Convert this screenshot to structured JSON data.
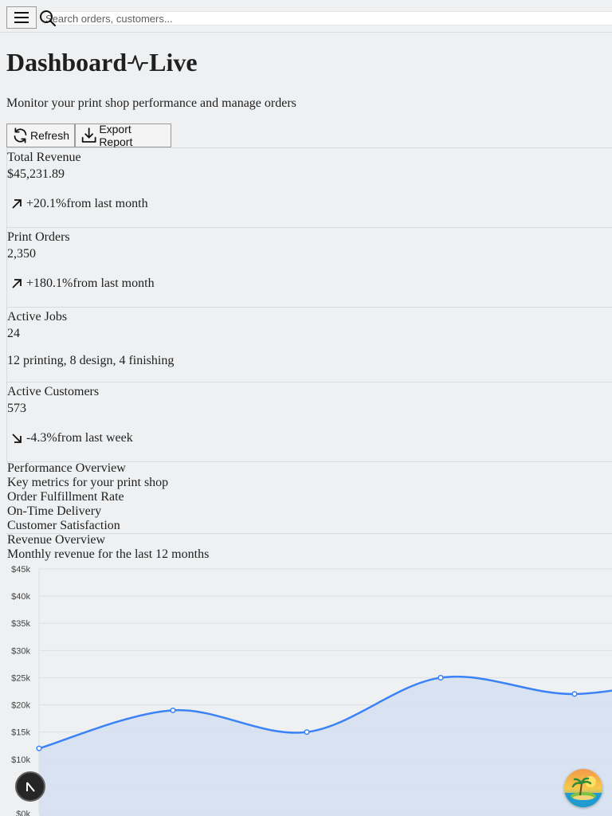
{
  "header": {
    "menu_icon": "hamburger-icon",
    "search_icon": "search-icon",
    "search_placeholder": "Search orders, customers..."
  },
  "page": {
    "title_left": "Dashboard",
    "title_icon": "pulse-icon",
    "title_right": "Live",
    "subtitle": "Monitor your print shop performance and manage orders"
  },
  "actions": {
    "refresh_label": "Refresh",
    "refresh_icon": "refresh-icon",
    "export_label": "Export Report",
    "export_icon": "download-icon"
  },
  "stats": [
    {
      "label": "Total Revenue",
      "value": "$45,231.89",
      "change": "+20.1%",
      "period": "from last month",
      "trend": "up"
    },
    {
      "label": "Print Orders",
      "value": "2,350",
      "change": "+180.1%",
      "period": "from last month",
      "trend": "up"
    },
    {
      "label": "Active Jobs",
      "value": "24",
      "detail": "12 printing, 8 design, 4 finishing"
    },
    {
      "label": "Active Customers",
      "value": "573",
      "change": "-4.3%",
      "period": "from last week",
      "trend": "down"
    }
  ],
  "performance": {
    "title": "Performance Overview",
    "description": "Key metrics for your print shop",
    "metrics": [
      "Order Fulfillment Rate",
      "On-Time Delivery",
      "Customer Satisfaction"
    ]
  },
  "revenue": {
    "title": "Revenue Overview",
    "description": "Monthly revenue for the last 12 months"
  },
  "colors": {
    "line": "#3b82f6",
    "area": "#d4dff0",
    "grid": "#dcdfe3"
  },
  "chart_data": {
    "type": "area",
    "y_ticks": [
      "$0k",
      "$5k",
      "$10k",
      "$15k",
      "$20k",
      "$25k",
      "$30k",
      "$35k",
      "$40k",
      "$45k"
    ],
    "ylim": [
      0,
      45000
    ],
    "x": [
      0,
      1,
      2,
      3,
      4,
      5
    ],
    "values": [
      12000,
      19000,
      15000,
      25000,
      22000,
      26000
    ],
    "grid": true,
    "legend": "none"
  },
  "floating": {
    "left_icon": "nextjs-logo-icon",
    "right_icon": "island-avatar-icon"
  }
}
